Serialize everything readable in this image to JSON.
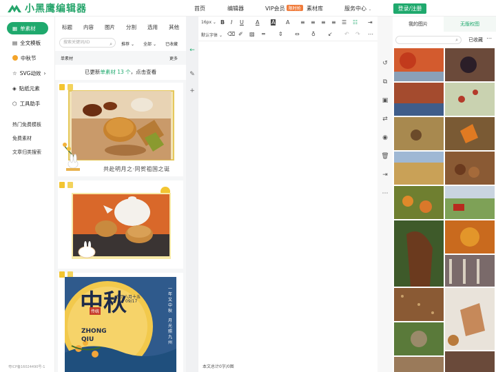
{
  "brand": {
    "name": "小黑鹰编辑器",
    "accent": "#1fa96d"
  },
  "nav": {
    "items": [
      "首页",
      "编辑器",
      "VIP会员",
      "素材库",
      "服务中心"
    ],
    "vip_badge": "限时抢",
    "login": "登录/注册"
  },
  "sidebar": {
    "items": [
      "单素材",
      "全文模板",
      "中秋节",
      "SVG动效",
      "贴纸元素",
      "工具助手"
    ],
    "links": [
      "热门免费模板",
      "免费素材",
      "文章归类搜索"
    ],
    "icp": "粤ICP备16024490号-1"
  },
  "panel": {
    "tabs": [
      "标题",
      "内容",
      "图片",
      "分割",
      "选用",
      "其他"
    ],
    "search_placeholder": "搜索关键词/ID",
    "filters": [
      "推荐",
      "全部",
      "已收藏"
    ],
    "head_left": "单素材",
    "head_right": "更多",
    "notice_pre": "已更新",
    "notice_hl": "单素材 13 个",
    "notice_post": "，点击查看",
    "cards": [
      {
        "caption": "共赴明月之·同贺祖国之诞"
      },
      {
        "caption": ""
      },
      {
        "poster_title": "中秋",
        "poster_date": "农历八月十五",
        "poster_day": "09/17",
        "poster_en1": "ZHONG",
        "poster_en2": "QIU",
        "poster_side1": "一年又中秋",
        "poster_side2": "月光照九州",
        "poster_tag": "传统"
      }
    ]
  },
  "editor": {
    "font_size": "16px",
    "font_family": "默认字体",
    "status": "本文总计0字/0图"
  },
  "rpanel": {
    "tabs": [
      "我的图片",
      "无版权图"
    ],
    "favorites": "已收藏"
  },
  "icons": [
    "grid-icon",
    "document-icon",
    "star-icon",
    "sticker-icon",
    "toolbox-icon",
    "search-icon",
    "chevron-down-icon",
    "undo-icon",
    "copy-icon",
    "save-icon",
    "swap-icon",
    "eye-icon",
    "trash-icon",
    "exit-icon",
    "more-icon",
    "arrow-left-icon",
    "edit-icon",
    "plus-icon"
  ]
}
